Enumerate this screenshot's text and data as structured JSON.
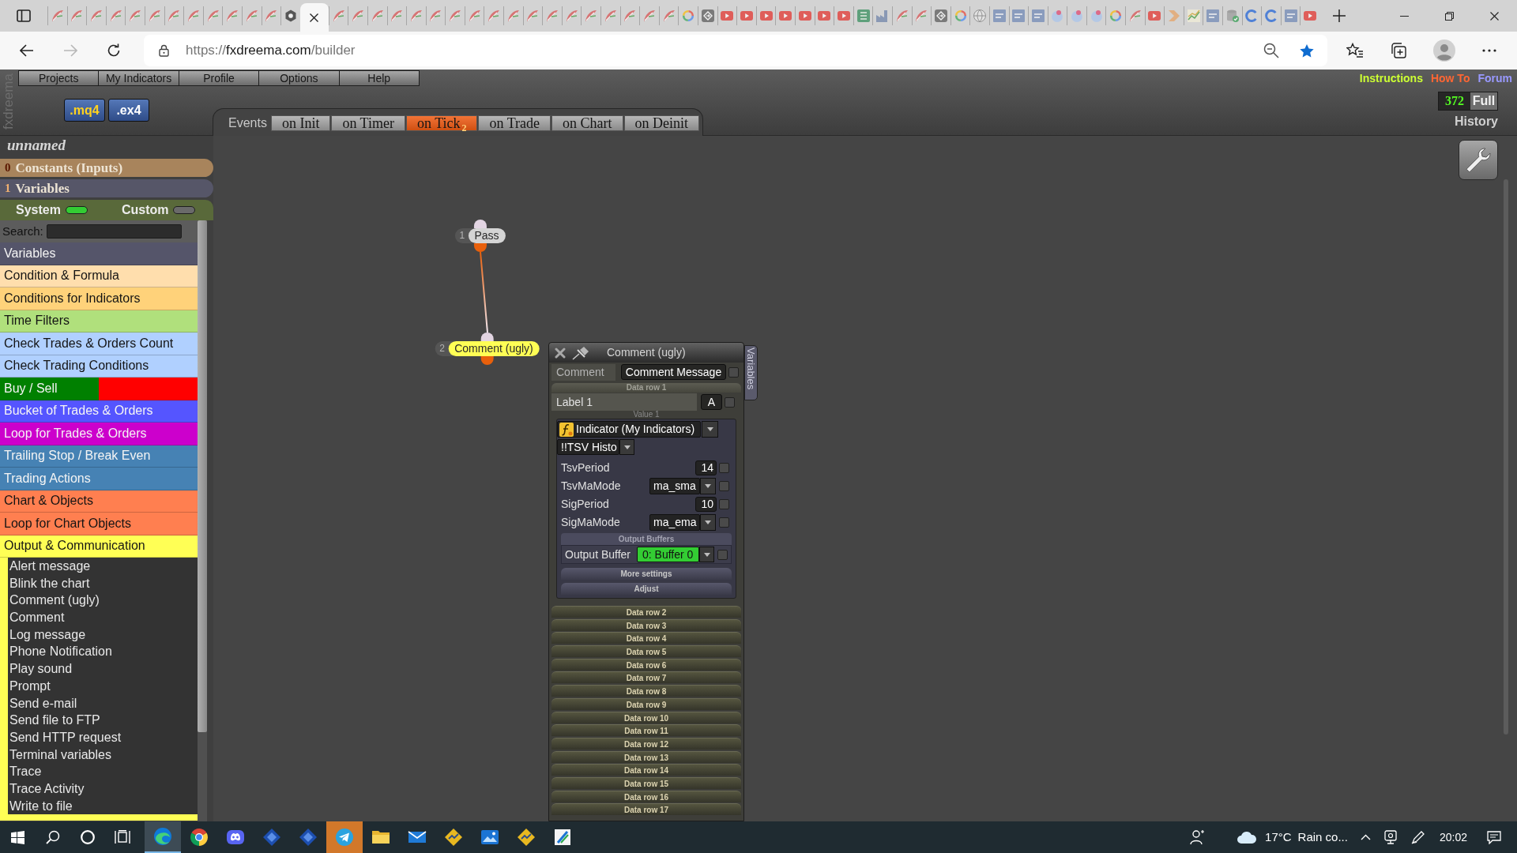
{
  "browser": {
    "tabs": [
      {
        "kind": "feather",
        "selected": false
      },
      {
        "kind": "feather",
        "selected": false
      },
      {
        "kind": "feather",
        "selected": false
      },
      {
        "kind": "feather",
        "selected": false
      },
      {
        "kind": "feather",
        "selected": false
      },
      {
        "kind": "feather",
        "selected": false
      },
      {
        "kind": "feather",
        "selected": false
      },
      {
        "kind": "feather",
        "selected": false
      },
      {
        "kind": "feather",
        "selected": false
      },
      {
        "kind": "feather",
        "selected": false
      },
      {
        "kind": "feather",
        "selected": false
      },
      {
        "kind": "feather",
        "selected": false
      },
      {
        "kind": "hexagon",
        "selected": false
      },
      {
        "selected": true
      },
      {
        "kind": "feather",
        "selected": false
      },
      {
        "kind": "feather",
        "selected": false
      },
      {
        "kind": "feather",
        "selected": false
      },
      {
        "kind": "feather",
        "selected": false
      },
      {
        "kind": "feather",
        "selected": false
      },
      {
        "kind": "feather",
        "selected": false
      },
      {
        "kind": "feather",
        "selected": false
      },
      {
        "kind": "feather",
        "selected": false
      },
      {
        "kind": "feather",
        "selected": false
      },
      {
        "kind": "feather",
        "selected": false
      },
      {
        "kind": "feather",
        "selected": false
      },
      {
        "kind": "feather",
        "selected": false
      },
      {
        "kind": "feather",
        "selected": false
      },
      {
        "kind": "feather",
        "selected": false
      },
      {
        "kind": "feather",
        "selected": false
      },
      {
        "kind": "feather",
        "selected": false
      },
      {
        "kind": "feather",
        "selected": false
      },
      {
        "kind": "feather",
        "selected": false
      },
      {
        "kind": "ring",
        "selected": false
      },
      {
        "kind": "arrow-tile",
        "selected": false
      },
      {
        "kind": "play",
        "selected": false
      },
      {
        "kind": "play",
        "selected": false
      },
      {
        "kind": "play",
        "selected": false
      },
      {
        "kind": "play",
        "selected": false
      },
      {
        "kind": "play",
        "selected": false
      },
      {
        "kind": "play",
        "selected": false
      },
      {
        "kind": "play",
        "selected": false
      },
      {
        "kind": "sheet",
        "selected": false
      },
      {
        "kind": "factory",
        "selected": false
      },
      {
        "kind": "feather",
        "selected": false
      },
      {
        "kind": "feather",
        "selected": false
      },
      {
        "kind": "arrow-tile",
        "selected": false
      },
      {
        "kind": "ring",
        "selected": false
      },
      {
        "kind": "globe",
        "selected": false
      },
      {
        "kind": "tile",
        "selected": false
      },
      {
        "kind": "tile",
        "selected": false
      },
      {
        "kind": "tile",
        "selected": false
      },
      {
        "kind": "dots",
        "selected": false
      },
      {
        "kind": "dots",
        "selected": false
      },
      {
        "kind": "dots",
        "selected": false
      },
      {
        "kind": "ring",
        "selected": false
      },
      {
        "kind": "feather",
        "selected": false
      },
      {
        "kind": "play",
        "selected": false
      },
      {
        "kind": "chevron",
        "selected": false
      },
      {
        "kind": "chart",
        "selected": false
      },
      {
        "kind": "tile",
        "selected": false
      },
      {
        "kind": "database",
        "selected": false
      },
      {
        "kind": "open-ring",
        "selected": false
      },
      {
        "kind": "open-ring",
        "selected": false
      },
      {
        "kind": "tile",
        "selected": false
      },
      {
        "kind": "play",
        "selected": false
      }
    ],
    "url": "https://fxdreema.com/builder",
    "bookmarked": true
  },
  "app": {
    "brand": "fxdreema",
    "menu": [
      "Projects",
      "My Indicators",
      "Profile",
      "Options",
      "Help"
    ],
    "file_buttons": [
      {
        "label": ".mq4",
        "kind": "source"
      },
      {
        "label": ".ex4",
        "kind": "compiled"
      }
    ],
    "links": [
      {
        "label": "Instructions",
        "color": "#ccff33"
      },
      {
        "label": "How To",
        "color": "#ff6633"
      },
      {
        "label": "Forum",
        "color": "#9999ff"
      }
    ],
    "counter": {
      "value": "372",
      "label": "Full"
    },
    "history": "History",
    "events": {
      "label": "Events",
      "tabs": [
        {
          "label": "on Init",
          "selected": false
        },
        {
          "label": "on Timer",
          "selected": false
        },
        {
          "label": "on Tick",
          "count": "2",
          "selected": true
        },
        {
          "label": "on Trade",
          "selected": false
        },
        {
          "label": "on Chart",
          "selected": false
        },
        {
          "label": "on Deinit",
          "selected": false
        }
      ]
    },
    "project": {
      "name": "unnamed",
      "sections": [
        {
          "count": "0",
          "label": "Constants (Inputs)",
          "color": "#a8845c"
        },
        {
          "count": "1",
          "label": "Variables",
          "color": "#565668"
        }
      ]
    },
    "toggles": [
      {
        "label": "System",
        "on": true
      },
      {
        "label": "Custom",
        "on": false
      }
    ],
    "search": {
      "label": "Search:"
    },
    "categories": [
      {
        "label": "Variables",
        "color": "#55556a"
      },
      {
        "label": "Condition & Formula",
        "color": "#ffdead"
      },
      {
        "label": "Conditions for Indicators",
        "color": "#ffd27a"
      },
      {
        "label": "Time Filters",
        "color": "#b0e07c"
      },
      {
        "label": "Check Trades & Orders Count",
        "color": "#b0d0ff"
      },
      {
        "label": "Check Trading Conditions",
        "color": "#b0d0ff"
      },
      {
        "label": "Buy / Sell",
        "color": "#008000",
        "second_half": {
          "color": "#ff0000"
        }
      },
      {
        "label": "Bucket of Trades & Orders",
        "color": "#5555ff"
      },
      {
        "label": "Loop for Trades & Orders",
        "color": "#cc00cc"
      },
      {
        "label": "Trailing Stop / Break Even",
        "color": "#4682b4"
      },
      {
        "label": "Trading Actions",
        "color": "#4682b4"
      },
      {
        "label": "Chart & Objects",
        "color": "#ff7f50"
      },
      {
        "label": "Loop for Chart Objects",
        "color": "#ff7f50"
      },
      {
        "label": "Output & Communication",
        "color": "#ffff55",
        "expanded": true,
        "children": [
          {
            "label": "Alert message"
          },
          {
            "label": "Blink the chart"
          },
          {
            "label": "Comment (ugly)"
          },
          {
            "label": "Comment"
          },
          {
            "label": "Log message"
          },
          {
            "label": "Phone Notification"
          },
          {
            "label": "Play sound"
          },
          {
            "label": "Prompt"
          },
          {
            "label": "Send e-mail"
          },
          {
            "label": "Send file to FTP"
          },
          {
            "label": "Send HTTP request"
          },
          {
            "label": "Terminal variables"
          },
          {
            "label": "Trace"
          },
          {
            "label": "Trace Activity"
          },
          {
            "label": "Write to file"
          }
        ]
      }
    ],
    "blocks": [
      {
        "number": "1",
        "label": "Pass",
        "color": "#d4d4d4",
        "children": [
          {
            "number": "2",
            "label": "Comment (ugly)",
            "color": "#ffff55"
          }
        ]
      }
    ],
    "panel": {
      "title": "Comment (ugly)",
      "side_tab": "Variables",
      "block_type": "Comment",
      "message": {
        "label": "Comment Message",
        "checked": false
      },
      "data_rows": [
        {
          "label": "Data row 1",
          "expanded": true,
          "name": {
            "value": "Label 1",
            "mode": "A",
            "checked": false
          },
          "value_caption": "Value 1",
          "source": "Indicator (My Indicators)",
          "indicator": "!!TSV Histo",
          "params": [
            {
              "name": "TsvPeriod",
              "kind": "number",
              "value": "14",
              "checked": false
            },
            {
              "name": "TsvMaMode",
              "kind": "select",
              "value": "ma_sma",
              "checked": false
            },
            {
              "name": "SigPeriod",
              "kind": "number",
              "value": "10",
              "checked": false
            },
            {
              "name": "SigMaMode",
              "kind": "select",
              "value": "ma_ema",
              "checked": false
            }
          ],
          "buffers": {
            "title": "Output Buffers",
            "label": "Output Buffer",
            "value": "0: Buffer 0",
            "checked": false
          },
          "buttons": [
            "More settings",
            "Adjust"
          ]
        },
        {
          "label": "Data row 2",
          "expanded": false
        },
        {
          "label": "Data row 3",
          "expanded": false
        },
        {
          "label": "Data row 4",
          "expanded": false
        },
        {
          "label": "Data row 5",
          "expanded": false
        },
        {
          "label": "Data row 6",
          "expanded": false
        },
        {
          "label": "Data row 7",
          "expanded": false
        },
        {
          "label": "Data row 8",
          "expanded": false
        },
        {
          "label": "Data row 9",
          "expanded": false
        },
        {
          "label": "Data row 10",
          "expanded": false
        },
        {
          "label": "Data row 11",
          "expanded": false
        },
        {
          "label": "Data row 12",
          "expanded": false
        },
        {
          "label": "Data row 13",
          "expanded": false
        },
        {
          "label": "Data row 14",
          "expanded": false
        },
        {
          "label": "Data row 15",
          "expanded": false
        },
        {
          "label": "Data row 16",
          "expanded": false
        },
        {
          "label": "Data row 17",
          "expanded": false
        }
      ]
    }
  },
  "taskbar": {
    "apps": [
      {
        "kind": "edge",
        "selected": true,
        "flashing": false
      },
      {
        "kind": "chrome",
        "selected": false,
        "flashing": false
      },
      {
        "kind": "discord",
        "selected": false,
        "flashing": false
      },
      {
        "kind": "diamond",
        "selected": false,
        "flashing": false
      },
      {
        "kind": "diamond",
        "selected": false,
        "flashing": false
      },
      {
        "kind": "telegram",
        "selected": false,
        "flashing": true
      },
      {
        "kind": "folder",
        "selected": false,
        "flashing": false
      },
      {
        "kind": "mail",
        "selected": false,
        "flashing": false
      },
      {
        "kind": "chart-app",
        "selected": false,
        "flashing": false
      },
      {
        "kind": "photos",
        "selected": false,
        "flashing": false
      },
      {
        "kind": "chart-app",
        "selected": false,
        "flashing": false
      },
      {
        "kind": "editor",
        "selected": false,
        "flashing": false
      }
    ],
    "weather": {
      "temperature": "17°C",
      "condition": "Rain co..."
    },
    "clock": "20:02"
  }
}
